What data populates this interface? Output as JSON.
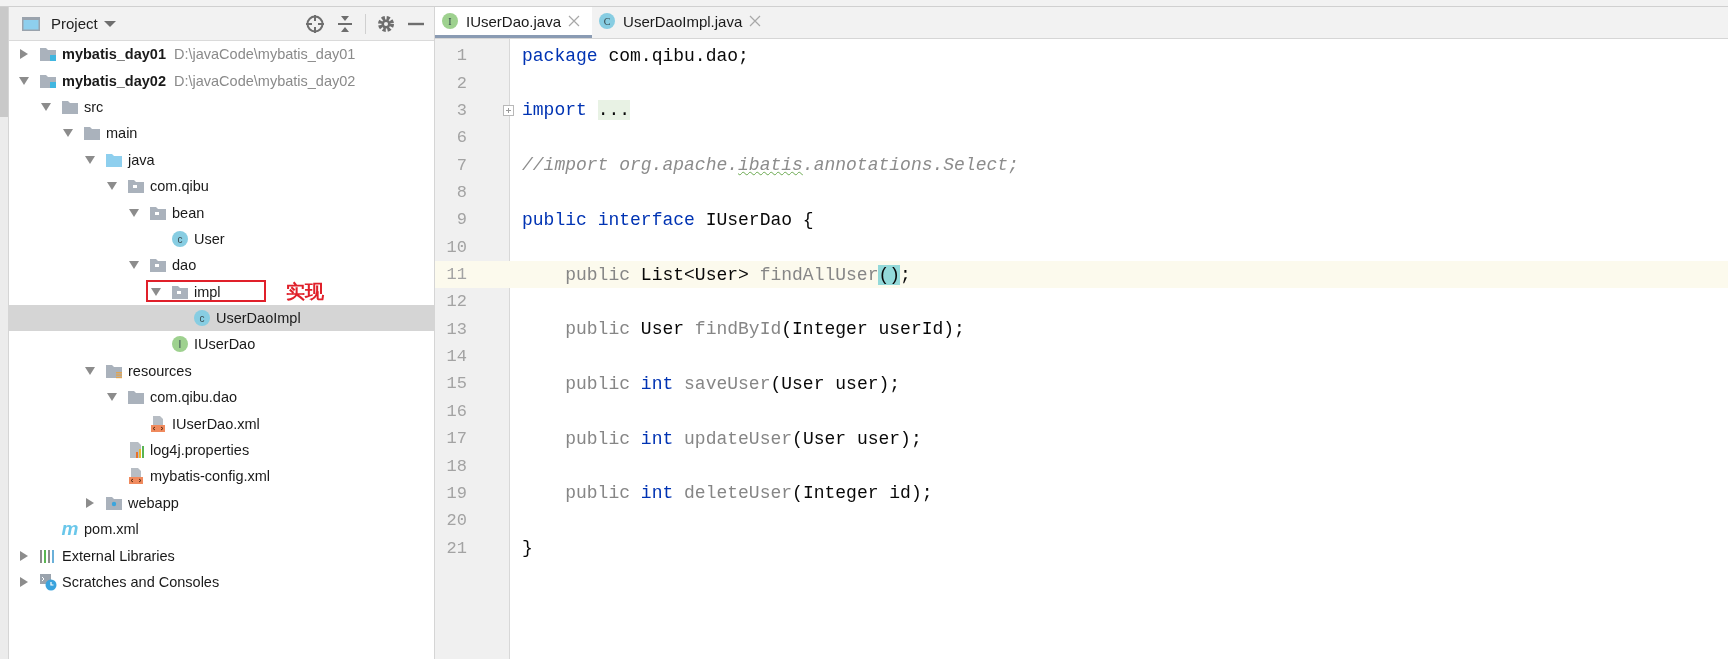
{
  "project_panel": {
    "title": "Project",
    "tree": [
      {
        "name": "mybatis_day01",
        "path": "D:\\javaCode\\mybatis_day01",
        "kind": "module",
        "expanded": false,
        "selected": false
      },
      {
        "name": "mybatis_day02",
        "path": "D:\\javaCode\\mybatis_day02",
        "kind": "module",
        "expanded": true,
        "selected": false,
        "children": [
          {
            "name": "src",
            "kind": "folder",
            "expanded": true,
            "selected": false,
            "children": [
              {
                "name": "main",
                "kind": "folder",
                "expanded": true,
                "selected": false,
                "children": [
                  {
                    "name": "java",
                    "kind": "source_folder",
                    "expanded": true,
                    "selected": false,
                    "children": [
                      {
                        "name": "com.qibu",
                        "kind": "package",
                        "expanded": true,
                        "selected": false,
                        "children": [
                          {
                            "name": "bean",
                            "kind": "package",
                            "expanded": true,
                            "selected": false,
                            "children": [
                              {
                                "name": "User",
                                "kind": "class",
                                "badge": "c",
                                "selected": false
                              }
                            ]
                          },
                          {
                            "name": "dao",
                            "kind": "package",
                            "expanded": true,
                            "selected": false,
                            "children": [
                              {
                                "name": "impl",
                                "kind": "package",
                                "expanded": true,
                                "selected": false,
                                "annotation": "实现",
                                "children": [
                                  {
                                    "name": "UserDaoImpl",
                                    "kind": "class",
                                    "badge": "c",
                                    "selected": true
                                  }
                                ]
                              },
                              {
                                "name": "IUserDao",
                                "kind": "interface",
                                "badge": "I",
                                "selected": false
                              }
                            ]
                          }
                        ]
                      }
                    ]
                  },
                  {
                    "name": "resources",
                    "kind": "resources",
                    "expanded": true,
                    "selected": false,
                    "children": [
                      {
                        "name": "com.qibu.dao",
                        "kind": "folder",
                        "expanded": true,
                        "selected": false,
                        "children": [
                          {
                            "name": "IUserDao.xml",
                            "kind": "xml",
                            "selected": false
                          }
                        ]
                      },
                      {
                        "name": "log4j.properties",
                        "kind": "properties",
                        "selected": false
                      },
                      {
                        "name": "mybatis-config.xml",
                        "kind": "xml",
                        "selected": false
                      }
                    ]
                  },
                  {
                    "name": "webapp",
                    "kind": "webapp",
                    "expanded": false,
                    "selected": false
                  }
                ]
              }
            ]
          },
          {
            "name": "pom.xml",
            "kind": "maven",
            "badge": "m",
            "selected": false
          }
        ]
      },
      {
        "name": "External Libraries",
        "kind": "libraries",
        "expanded": false,
        "selected": false
      },
      {
        "name": "Scratches and Consoles",
        "kind": "scratches",
        "expanded": false,
        "selected": false
      }
    ]
  },
  "editor": {
    "tabs": [
      {
        "label": "IUserDao.java",
        "kind": "interface",
        "badge": "I",
        "selected": true
      },
      {
        "label": "UserDaoImpl.java",
        "kind": "class",
        "badge": "C",
        "selected": false
      }
    ],
    "lines": [
      {
        "number": "1",
        "current": false,
        "foldable": false,
        "tokens": [
          {
            "kind": "keyword",
            "text": "package"
          },
          {
            "kind": "text",
            "text": " com.qibu.dao;"
          }
        ]
      },
      {
        "number": "2",
        "current": false,
        "foldable": false
      },
      {
        "number": "3",
        "current": false,
        "foldable": true,
        "tokens": [
          {
            "kind": "keyword",
            "text": "import "
          },
          {
            "kind": "folded",
            "text": "..."
          }
        ]
      },
      {
        "number": "6",
        "current": false,
        "foldable": false
      },
      {
        "number": "7",
        "current": false,
        "foldable": false,
        "tokens": [
          {
            "kind": "comment",
            "text": "//import org.apache."
          },
          {
            "kind": "comment_typo",
            "text": "ibatis"
          },
          {
            "kind": "comment",
            "text": ".annotations.Select;"
          }
        ]
      },
      {
        "number": "8",
        "current": false,
        "foldable": false
      },
      {
        "number": "9",
        "current": false,
        "foldable": false,
        "tokens": [
          {
            "kind": "keyword",
            "text": "public "
          },
          {
            "kind": "keyword",
            "text": "interface"
          },
          {
            "kind": "text",
            "text": " IUserDao {"
          }
        ]
      },
      {
        "number": "10",
        "current": false,
        "foldable": false
      },
      {
        "number": "11",
        "current": true,
        "foldable": false,
        "tokens": [
          {
            "kind": "muted",
            "text": "    public"
          },
          {
            "kind": "text",
            "text": " List<User> "
          },
          {
            "kind": "muted",
            "text": "findAllUser"
          },
          {
            "kind": "match",
            "text": "()"
          },
          {
            "kind": "text",
            "text": ";"
          }
        ]
      },
      {
        "number": "12",
        "current": false,
        "foldable": false
      },
      {
        "number": "13",
        "current": false,
        "foldable": false,
        "tokens": [
          {
            "kind": "muted",
            "text": "    public"
          },
          {
            "kind": "text",
            "text": " User "
          },
          {
            "kind": "muted",
            "text": "findById"
          },
          {
            "kind": "text",
            "text": "(Integer userId);"
          }
        ]
      },
      {
        "number": "14",
        "current": false,
        "foldable": false
      },
      {
        "number": "15",
        "current": false,
        "foldable": false,
        "tokens": [
          {
            "kind": "muted",
            "text": "    public "
          },
          {
            "kind": "keyword",
            "text": "int "
          },
          {
            "kind": "muted",
            "text": "saveUser"
          },
          {
            "kind": "text",
            "text": "(User user);"
          }
        ]
      },
      {
        "number": "16",
        "current": false,
        "foldable": false
      },
      {
        "number": "17",
        "current": false,
        "foldable": false,
        "tokens": [
          {
            "kind": "muted",
            "text": "    public "
          },
          {
            "kind": "keyword",
            "text": "int "
          },
          {
            "kind": "muted",
            "text": "updateUser"
          },
          {
            "kind": "text",
            "text": "(User user);"
          }
        ]
      },
      {
        "number": "18",
        "current": false,
        "foldable": false
      },
      {
        "number": "19",
        "current": false,
        "foldable": false,
        "tokens": [
          {
            "kind": "muted",
            "text": "    public "
          },
          {
            "kind": "keyword",
            "text": "int "
          },
          {
            "kind": "muted",
            "text": "deleteUser"
          },
          {
            "kind": "text",
            "text": "(Integer id);"
          }
        ]
      },
      {
        "number": "20",
        "current": false,
        "foldable": false
      },
      {
        "number": "21",
        "current": false,
        "foldable": false,
        "tokens": [
          {
            "kind": "text",
            "text": "}"
          }
        ]
      }
    ]
  }
}
